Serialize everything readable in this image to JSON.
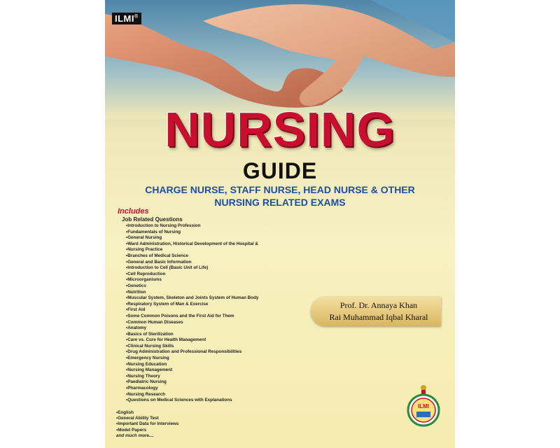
{
  "brand": {
    "name": "ILMI",
    "mark": "®"
  },
  "title": "NURSING",
  "subtitle": "GUIDE",
  "tagline": [
    "CHARGE NURSE, STAFF NURSE, HEAD NURSE & OTHER",
    "NURSING RELATED EXAMS"
  ],
  "includes_label": "Includes",
  "job_related_label": "Job Related Questions",
  "topics": [
    "Introduction to Nursing Profession",
    "Fundamentals of Nursing",
    "General Nursing",
    "Ward Administration, Historical Development of the Hospital &",
    "Nursing Practice",
    "Branches of Medical Science",
    "General and Basic Information",
    "Introduction to Cell (Basic Unit of Life)",
    "Cell Reproduction",
    "Microorganisms",
    "Genetics",
    "Nutrition",
    "Muscular System, Skeleton and Joints System of Human Body",
    "Respiratory System of Man & Exercise",
    "First Aid",
    "Some Common Poisons and the First Aid for Them",
    "Common Human Diseases",
    "Anatomy",
    "Basics of Sterilization",
    "Care vs. Cure for Health Management",
    "Clinical Nursing Skills",
    "Drug Administration and Professional Responsibilities",
    "Emergency Nursing",
    "Nursing Education",
    "Nursing Management",
    "Nursing Theory",
    "Paediatric Nursing",
    "Pharmacology",
    "Nursing Research",
    "Questions on Medical Sciences with Explanations"
  ],
  "extras": [
    "English",
    "General Ability Test",
    "Important Data for Interviews",
    "Model Papers"
  ],
  "extras_more": "and much more....",
  "authors": [
    "Prof. Dr. Annaya Khan",
    "Rai Muhammad Iqbal Kharal"
  ],
  "publisher_logo_text": "ILMI",
  "colors": {
    "title_red": "#c8102e",
    "tagline_blue": "#1c4fa0",
    "author_gold": "#d9b660"
  }
}
